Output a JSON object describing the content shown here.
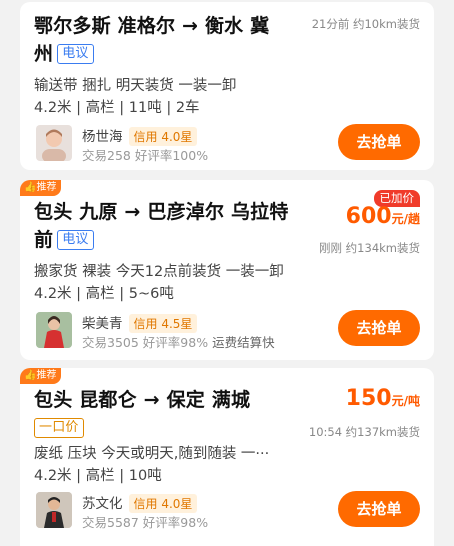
{
  "cards": [
    {
      "route_line1": "鄂尔多斯 准格尔 → 衡水 冀",
      "route_line2": "州",
      "route_tag": "电议",
      "meta_top": "21分前 约10km装货",
      "desc1": "输送带 捆扎 明天装货 一装一卸",
      "desc2": "4.2米 | 高栏 | 11吨 | 2车",
      "user_name": "杨世海",
      "credit": "信用 4.0星",
      "stats": "交易258 好评率100%",
      "stats_extra": "",
      "button": "去抢单"
    },
    {
      "badge": "推荐",
      "route_line1": "包头 九原 → 巴彦淖尔 乌拉特",
      "route_line2": "前",
      "route_tag": "电议",
      "price_badge": "已加价",
      "price_value": "600",
      "price_unit": "元/趟",
      "meta_top": "刚刚 约134km装货",
      "desc1": "搬家货 裸装 今天12点前装货 一装一卸",
      "desc2": "4.2米 | 高栏 | 5~6吨",
      "user_name": "柴美青",
      "credit": "信用 4.5星",
      "stats": "交易3505 好评率98%",
      "stats_extra": "运费结算快",
      "button": "去抢单"
    },
    {
      "badge": "推荐",
      "route_line1": "包头 昆都仑 → 保定 满城",
      "route_tag": "一口价",
      "price_value": "150",
      "price_unit": "元/吨",
      "meta_top": "10:54 约137km装货",
      "desc1": "废纸 压块 今天或明天,随到随装 一···",
      "desc2": "4.2米 | 高栏 | 10吨",
      "user_name": "苏文化",
      "credit": "信用 4.0星",
      "stats": "交易5587 好评率98%",
      "stats_extra": "",
      "button": "去抢单"
    }
  ],
  "colors": {
    "accent": "#ff6a00",
    "price": "#ff5a00",
    "tag_blue": "#3a7cf0"
  }
}
